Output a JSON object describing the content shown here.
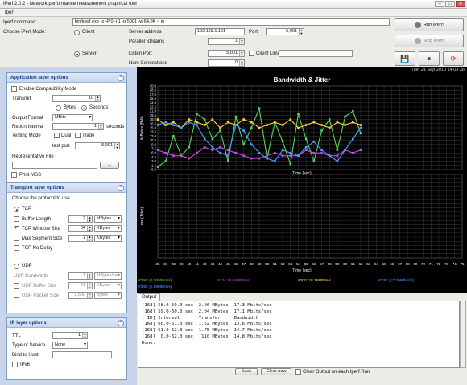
{
  "window": {
    "title": "iPerf 2.0.2 - Network performance measurement graphical tool",
    "min": "–",
    "max": "□",
    "close": "✕"
  },
  "menu": {
    "iperf": "Iperf"
  },
  "config": {
    "command_label": "Iperf command:",
    "command_value": "bin/iperf.exe -s -P 0 -i 1 -p 5001 -w 64.0K -f m",
    "mode_label": "Choose iPerf Mode:",
    "client_label": "Client",
    "server_label": "Server",
    "server_address_label": "Server address",
    "server_address_value": "192.168.1.101",
    "port_label": "Port",
    "port_value": "5,001",
    "parallel_label": "Parallel Streams",
    "parallel_value": "1",
    "listen_port_label": "Listen Port",
    "listen_port_value": "5,001",
    "client_limit_label": "Client Limit",
    "num_conn_label": "Num Connections",
    "num_conn_value": "0",
    "run_label": "Run IPerf!",
    "stop_label": "Stop IPerf!",
    "datetime": "Tue, 21 Sep 2010 14:03:38"
  },
  "app_panel": {
    "title": "Application layer options",
    "compat_label": "Enable Compatibility Mode",
    "transmit_label": "Transmit",
    "transmit_value": "10",
    "bytes_label": "Bytes",
    "seconds_label": "Seconds",
    "format_label": "Output Format",
    "format_value": "MBits",
    "interval_label": "Report Interval",
    "interval_value": "1",
    "interval_unit": "seconds",
    "testing_label": "Testing Mode",
    "dual_label": "Dual",
    "trade_label": "Trade",
    "test_port_label": "test port",
    "test_port_value": "5,001",
    "rep_file_label": "Representative File",
    "browse_label": "...",
    "mss_label": "Print MSS"
  },
  "transport_panel": {
    "title": "Transport layer options",
    "choose_label": "Choose the protocol to use",
    "tcp_label": "TCP",
    "buf_label": "Buffer Length",
    "buf_value": "2",
    "buf_unit": "MBytes",
    "win_label": "TCP Window Size",
    "win_value": "64",
    "win_unit": "KBytes",
    "mss_label": "Max Segment Size",
    "mss_value": "1",
    "mss_unit": "KBytes",
    "nodelay_label": "TCP No Delay",
    "udp_label": "UDP",
    "udp_bw_label": "UDP Bandwidth",
    "udp_bw_value": "1",
    "udp_bw_unit": "MBytes/sec",
    "udp_buf_label": "UDP Buffer Size",
    "udp_buf_value": "41",
    "udp_buf_unit": "KBytes",
    "udp_pkt_label": "UDP Packet Size",
    "udp_pkt_value": "1,500",
    "udp_pkt_unit": "Bytes"
  },
  "ip_panel": {
    "title": "IP layer options",
    "ttl_label": "TTL",
    "ttl_value": "1",
    "tos_label": "Type of Service",
    "tos_value": "None",
    "bind_label": "Bind to Host",
    "ipv6_label": "IPv6"
  },
  "output": {
    "tab_label": "Output",
    "lines": [
      "[168] 58.0-59.0 sec  2.06 MBytes  17.3 Mbits/sec",
      "[168] 59.0-60.0 sec  2.04 MBytes  17.1 Mbits/sec",
      "[ ID] Interval       Transfer     Bandwidth",
      "[168] 60.0-61.0 sec  1.62 MBytes  13.6 Mbits/sec",
      "[168] 61.0-62.0 sec  1.75 MBytes  14.7 Mbits/sec",
      "[168]  0.0-62.0 sec   110 MBytes  14.8 Mbits/sec",
      "Done."
    ],
    "save_label": "Save",
    "clear_label": "Clear now",
    "clear_each_label": "Clear Output on each Iperf Run"
  },
  "chart_data": {
    "type": "line",
    "title": "Bandwidth & Jitter",
    "xlabel": "Time (sec)",
    "ylabel": "MBytes (BW)",
    "ylabel2": "ms (Jitter)",
    "x": [
      36,
      37,
      38,
      39,
      40,
      41,
      42,
      43,
      44,
      45,
      46,
      47,
      48,
      49,
      50,
      51,
      52,
      53,
      54,
      55,
      56,
      57,
      58,
      59,
      60,
      61,
      62,
      63,
      64,
      65,
      66,
      67,
      68,
      69,
      70,
      71,
      72,
      73,
      74,
      75
    ],
    "ylim": [
      0,
      30
    ],
    "yticks": [
      0,
      1.5,
      3,
      4.5,
      6,
      7.5,
      9,
      10.5,
      12,
      13.5,
      15,
      16.5,
      18,
      19.5,
      21,
      22.5,
      24,
      25.5,
      27,
      28.5,
      30
    ],
    "colors": {
      "background": "#000000",
      "grid": "#3a3a3a",
      "text": "#ffffff"
    },
    "series": [
      {
        "name": "#296: [0.50MBits/s]",
        "color": "#5ad15a",
        "x": [
          36,
          37,
          38,
          39,
          40,
          41,
          42,
          43,
          44,
          45,
          46,
          47,
          48,
          49,
          50,
          51,
          52,
          53,
          54,
          55,
          56,
          57,
          58,
          59,
          60,
          61,
          62
        ],
        "values": [
          1,
          3,
          12,
          5,
          8,
          20,
          18,
          11,
          14,
          3,
          19,
          9,
          15,
          22,
          4,
          17,
          10,
          2,
          20,
          11,
          3,
          14,
          18,
          7,
          19,
          21,
          13
        ]
      },
      {
        "name": "#324: [6.99MBits/s]",
        "color": "#c24cf0",
        "x": [
          36,
          37,
          38,
          39,
          40,
          41,
          42,
          43,
          44,
          45,
          46,
          47,
          48,
          49,
          50,
          51,
          52,
          53,
          54,
          55,
          56,
          57,
          58,
          59,
          60,
          61,
          62
        ],
        "values": [
          7,
          6,
          5,
          5,
          4,
          6,
          8,
          7,
          8,
          7,
          6,
          5,
          4,
          4,
          5,
          6,
          5,
          5,
          5,
          7,
          6,
          6,
          5,
          5,
          7,
          6,
          7
        ]
      },
      {
        "name": "#300: 28.18MBits/s",
        "color": "#ffd43b",
        "x": [
          36,
          37,
          38,
          39,
          40,
          41,
          42,
          43,
          44,
          45,
          46,
          47,
          48,
          49,
          50,
          51,
          52,
          53,
          54,
          55,
          56,
          57,
          58,
          59,
          60,
          61,
          62
        ],
        "values": [
          18,
          16,
          17,
          15,
          18,
          17,
          16,
          18,
          15,
          17,
          16,
          18,
          17,
          15,
          16,
          17,
          16,
          18,
          15,
          16,
          17,
          16,
          15,
          17,
          16,
          17,
          16
        ]
      },
      {
        "name": "#308: [17.20MBits/s]",
        "color": "#4aa0ff",
        "x": [
          36,
          37,
          38,
          39,
          40,
          41,
          42,
          43,
          44,
          45,
          46,
          47,
          48,
          49,
          50,
          51,
          52,
          53,
          54,
          55,
          56,
          57,
          58,
          59,
          60,
          61,
          62
        ],
        "values": [
          16,
          17,
          16,
          15,
          17,
          16,
          11,
          8,
          6,
          5,
          16,
          14,
          9,
          6,
          4,
          3,
          7,
          6,
          5,
          8,
          10,
          7,
          5,
          3,
          7,
          11,
          15
        ]
      }
    ],
    "legend_extra": "#348: [0.98MBits/s]"
  }
}
